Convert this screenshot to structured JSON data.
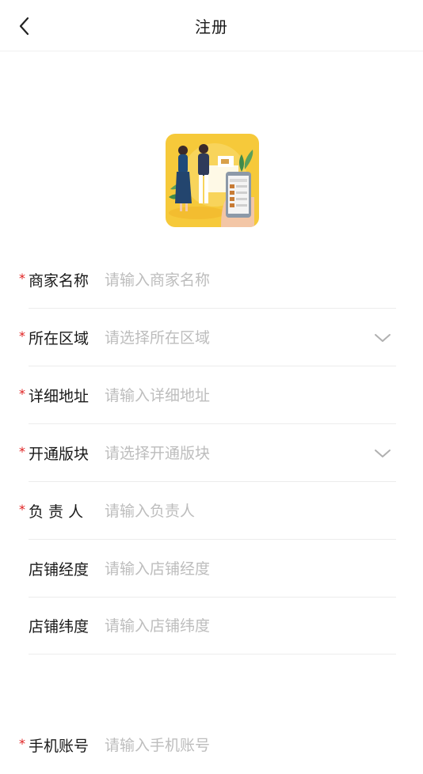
{
  "header": {
    "title": "注册"
  },
  "form": {
    "fields": [
      {
        "label": "商家名称",
        "placeholder": "请输入商家名称",
        "required": true
      },
      {
        "label": "所在区域",
        "placeholder": "请选择所在区域",
        "required": true
      },
      {
        "label": "详细地址",
        "placeholder": "请输入详细地址",
        "required": true
      },
      {
        "label": "开通版块",
        "placeholder": "请选择开通版块",
        "required": true
      },
      {
        "label": "负 责 人",
        "placeholder": "请输入负责人",
        "required": true
      },
      {
        "label": "店铺经度",
        "placeholder": "请输入店铺经度",
        "required": false
      },
      {
        "label": "店铺纬度",
        "placeholder": "请输入店铺纬度",
        "required": false
      },
      {
        "label": "手机账号",
        "placeholder": "请输入手机账号",
        "required": true
      }
    ],
    "required_mark": "*"
  },
  "colors": {
    "required": "#e02020",
    "logo_bg": "#f6c93a",
    "placeholder": "#bdbdbd"
  },
  "icons": {
    "back": "chevron-left-icon",
    "dropdown": "chevron-down-icon"
  }
}
